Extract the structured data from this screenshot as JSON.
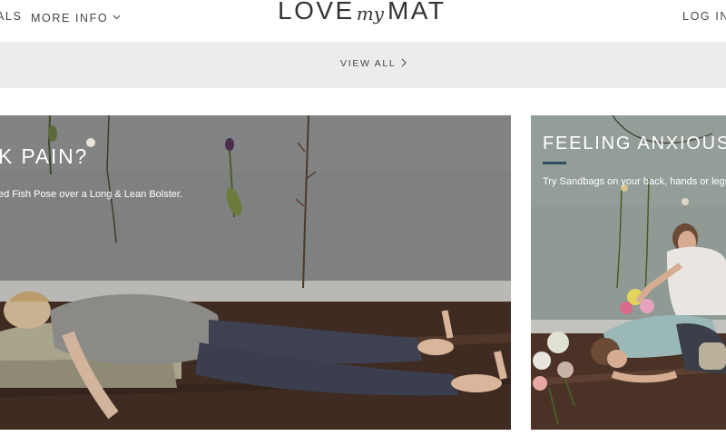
{
  "header": {
    "nav_left": [
      {
        "label": "ALS"
      },
      {
        "label": "MORE INFO"
      }
    ],
    "logo": {
      "part1": "LOVE",
      "part2": "my",
      "part3": "MAT"
    },
    "login_label": "LOG IN"
  },
  "bar": {
    "view_all_label": "VIEW ALL"
  },
  "cards": [
    {
      "title": "K PAIN?",
      "text": "ed Fish Pose over a Long & Lean Bolster."
    },
    {
      "title": "FEELING ANXIOUS?",
      "text": "Try Sandbags on your back, hands or legs."
    }
  ],
  "icons": {
    "more_info_chevron": "chevron-down-icon",
    "view_all_chevron": "chevron-right-icon"
  },
  "colors": {
    "header_bg": "#ffffff",
    "bar_bg": "#ececec",
    "wall": "#7d7f7e",
    "floor": "#3d2a22",
    "accent_rule": "#2f4f5f",
    "text": "#444444"
  }
}
